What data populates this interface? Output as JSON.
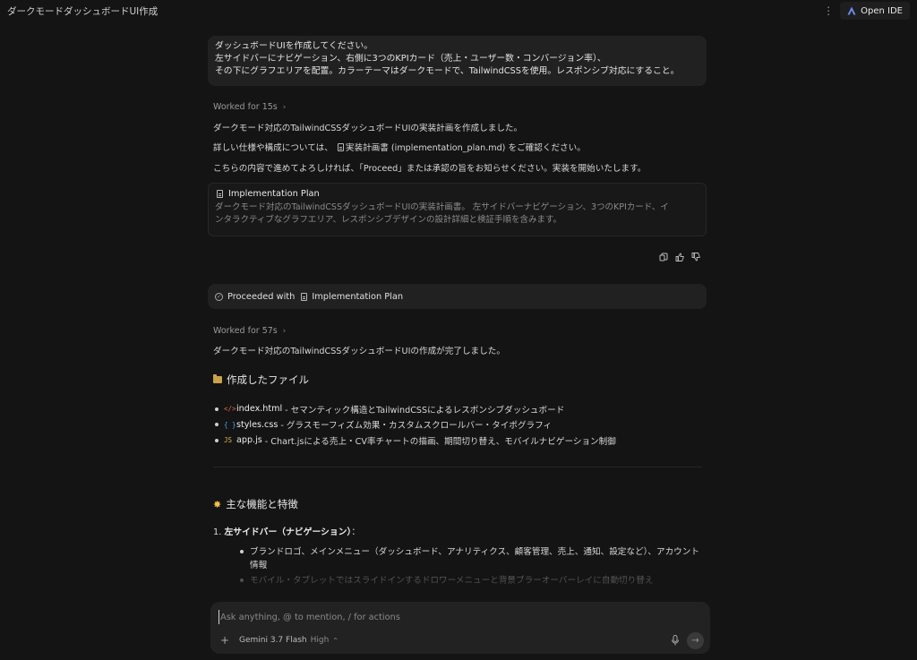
{
  "window": {
    "title": "ダークモードダッシュボードUI作成"
  },
  "topbar": {
    "open_ide_label": "Open IDE"
  },
  "user_message": {
    "lines": [
      "ダッシュボードUIを作成してください。",
      "左サイドバーにナビゲーション、右側に3つのKPIカード（売上・ユーザー数・コンバージョン率）、",
      "その下にグラフエリアを配置。カラーテーマはダークモードで、TailwindCSSを使用。レスポンシブ対応にすること。"
    ]
  },
  "response1": {
    "worked": "Worked for 15s",
    "line1": "ダークモード対応のTailwindCSSダッシュボードUIの実装計画を作成しました。",
    "line2_prefix": "詳しい仕様や構成については、",
    "line2_link": "実装計画書 (implementation_plan.md)",
    "line2_suffix": "をご確認ください。",
    "line3": "こちらの内容で進めてよろしければ、「Proceed」または承認の旨をお知らせください。実装を開始いたします。",
    "plan_card": {
      "title": "Implementation Plan",
      "desc_line1": "ダークモード対応のTailwindCSSダッシュボードUIの実装計画書。 左サイドバーナビゲーション、3つのKPIカード、イ",
      "desc_line2": "ンタラクティブなグラフエリア、レスポンシブデザインの設計詳細と検証手順を含みます。"
    }
  },
  "proceeded": {
    "prefix": "Proceeded with",
    "link": "Implementation Plan"
  },
  "response2": {
    "worked": "Worked for 57s",
    "line1": "ダークモード対応のTailwindCSSダッシュボードUIの作成が完了しました。",
    "files_heading": "作成したファイル",
    "files": [
      {
        "icon": "</>",
        "name": "index.html",
        "desc": "- セマンティック構造とTailwindCSSによるレスポンシブダッシュボード",
        "color": "#e06c4f"
      },
      {
        "icon": "{ }",
        "name": "styles.css",
        "desc": "- グラスモーフィズム効果・カスタムスクロールバー・タイポグラフィ",
        "color": "#4fa3e0"
      },
      {
        "icon": "JS",
        "name": "app.js",
        "desc": "- Chart.jsによる売上・CV率チャートの描画、期間切り替え、モバイルナビゲーション制御",
        "color": "#e0b64f"
      }
    ],
    "features_heading": "主な機能と特徴",
    "item1_number": "1.",
    "item1_title": "左サイドバー（ナビゲーション）",
    "item1_colon": "：",
    "item1_bullets": [
      "ブランドロゴ、メインメニュー（ダッシュボード、アナリティクス、顧客管理、売上、通知、設定など）、アカウント情報",
      "モバイル・タブレットではスライドインするドロワーメニューと背景ブラーオーバーレイに自動切り替え"
    ]
  },
  "composer": {
    "placeholder": "Ask anything, @ to mention, / for actions",
    "model": "Gemini 3.7 Flash",
    "effort": "High"
  }
}
